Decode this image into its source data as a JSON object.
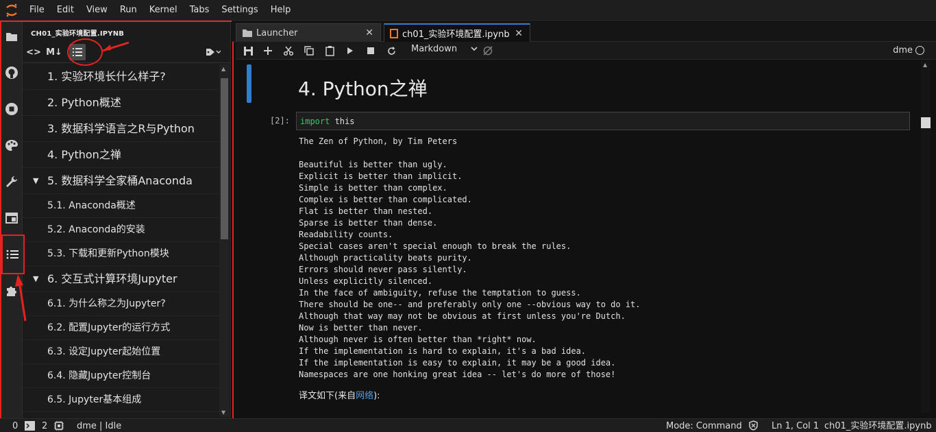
{
  "menubar": {
    "items": [
      "File",
      "Edit",
      "View",
      "Run",
      "Kernel",
      "Tabs",
      "Settings",
      "Help"
    ]
  },
  "iconbar": {
    "icons": [
      "folder-icon",
      "github-icon",
      "stop-circle-icon",
      "palette-icon",
      "wrench-icon",
      "tab-icon",
      "toc-icon",
      "puzzle-icon"
    ]
  },
  "sidepanel": {
    "title": "CH01_实验环境配置.IPYNB",
    "toolbar": {
      "code_label": "<>",
      "markdown_label": "M↓"
    },
    "toc": [
      {
        "label": "1. 实验环境长什么样子?",
        "level": 1
      },
      {
        "label": "2. Python概述",
        "level": 1
      },
      {
        "label": "3. 数据科学语言之R与Python",
        "level": 1
      },
      {
        "label": "4. Python之禅",
        "level": 1
      },
      {
        "label": "5. 数据科学全家桶Anaconda",
        "level": 1,
        "expanded": true
      },
      {
        "label": "5.1. Anaconda概述",
        "level": 2
      },
      {
        "label": "5.2. Anaconda的安装",
        "level": 2
      },
      {
        "label": "5.3. 下载和更新Python模块",
        "level": 2
      },
      {
        "label": "6. 交互式计算环境Jupyter",
        "level": 1,
        "expanded": true
      },
      {
        "label": "6.1. 为什么称之为Jupyter?",
        "level": 2
      },
      {
        "label": "6.2. 配置Jupyter的运行方式",
        "level": 2
      },
      {
        "label": "6.3. 设定Jupyter起始位置",
        "level": 2
      },
      {
        "label": "6.4. 隐藏Jupyter控制台",
        "level": 2
      },
      {
        "label": "6.5. Jupyter基本组成",
        "level": 2
      }
    ]
  },
  "tabs": [
    {
      "label": "Launcher",
      "close": "✕"
    },
    {
      "label": "ch01_实验环境配置.ipynb",
      "close": "✕",
      "active": true
    }
  ],
  "nbtoolbar": {
    "cell_type": "Markdown",
    "kernel": "dme"
  },
  "notebook": {
    "heading": "4. Python之禅",
    "prompt": "[2]:",
    "code_keyword": "import",
    "code_rest": " this",
    "output_lines": [
      "The Zen of Python, by Tim Peters",
      "",
      "Beautiful is better than ugly.",
      "Explicit is better than implicit.",
      "Simple is better than complex.",
      "Complex is better than complicated.",
      "Flat is better than nested.",
      "Sparse is better than dense.",
      "Readability counts.",
      "Special cases aren't special enough to break the rules.",
      "Although practicality beats purity.",
      "Errors should never pass silently.",
      "Unless explicitly silenced.",
      "In the face of ambiguity, refuse the temptation to guess.",
      "There should be one-- and preferably only one --obvious way to do it.",
      "Although that way may not be obvious at first unless you're Dutch.",
      "Now is better than never.",
      "Although never is often better than *right* now.",
      "If the implementation is hard to explain, it's a bad idea.",
      "If the implementation is easy to explain, it may be a good idea.",
      "Namespaces are one honking great idea -- let's do more of those!"
    ],
    "translated_prefix": "译文如下(来自",
    "translated_link": "网络",
    "translated_suffix": "):"
  },
  "statusbar": {
    "left_count1": "0",
    "left_count2": "2",
    "kernel_status": "dme | Idle",
    "mode": "Mode: Command",
    "cursor": "Ln 1, Col 1",
    "filename": "ch01_实验环境配置.ipynb"
  },
  "colors": {
    "accent": "#2f7fd0",
    "annotation": "#e52320",
    "keyword": "#3ec56c",
    "link": "#4f9ee8"
  }
}
